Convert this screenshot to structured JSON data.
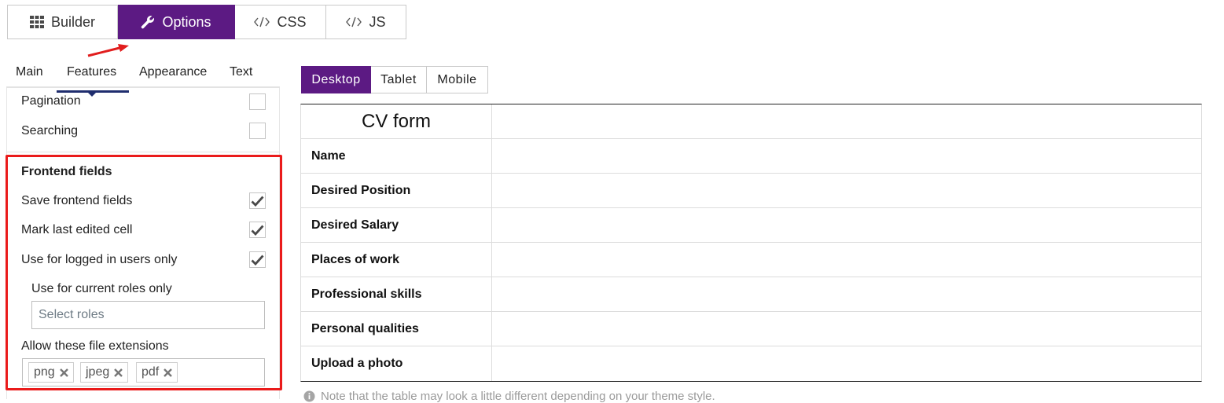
{
  "top_tabs": {
    "builder": "Builder",
    "options": "Options",
    "css": "CSS",
    "js": "JS",
    "active": "options"
  },
  "sub_tabs": {
    "main": "Main",
    "features": "Features",
    "appearance": "Appearance",
    "text": "Text",
    "active": "features"
  },
  "options": {
    "pagination": {
      "label": "Pagination",
      "checked": false
    },
    "searching": {
      "label": "Searching",
      "checked": false
    }
  },
  "frontend": {
    "title": "Frontend fields",
    "save_fields": {
      "label": "Save frontend fields",
      "checked": true
    },
    "mark_last": {
      "label": "Mark last edited cell",
      "checked": true
    },
    "logged_in": {
      "label": "Use for logged in users only",
      "checked": true
    },
    "roles_label": "Use for current roles only",
    "roles_placeholder": "Select roles",
    "extensions_label": "Allow these file extensions",
    "extensions": [
      "png",
      "jpeg",
      "pdf"
    ]
  },
  "device_tabs": {
    "desktop": "Desktop",
    "tablet": "Tablet",
    "mobile": "Mobile",
    "active": "desktop"
  },
  "table": {
    "title": "CV form",
    "rows": [
      "Name",
      "Desired Position",
      "Desired Salary",
      "Places of work",
      "Professional skills",
      "Personal qualities",
      "Upload a photo"
    ]
  },
  "note": "Note that the table may look a little different depending on your theme style.",
  "colors": {
    "accent": "#5c1a83",
    "highlight_box": "#ea1b1b",
    "tab_underline": "#1f2d6e"
  },
  "icons": {
    "builder": "grid-icon",
    "options": "wrench-icon",
    "css": "code-icon",
    "js": "code-icon",
    "checkbox": "checkmark-icon",
    "tag_remove": "close-icon",
    "note": "info-icon"
  }
}
